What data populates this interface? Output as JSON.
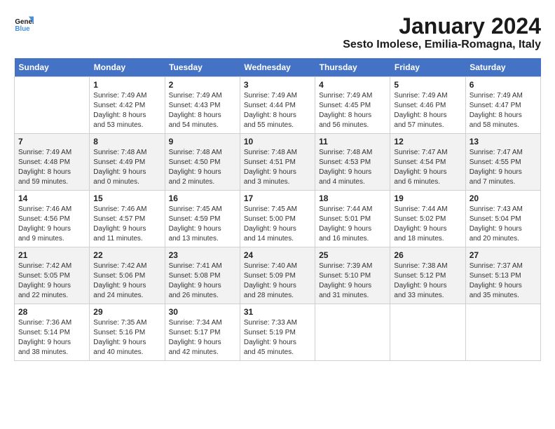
{
  "header": {
    "logo_line1": "General",
    "logo_line2": "Blue",
    "title": "January 2024",
    "subtitle": "Sesto Imolese, Emilia-Romagna, Italy"
  },
  "columns": [
    "Sunday",
    "Monday",
    "Tuesday",
    "Wednesday",
    "Thursday",
    "Friday",
    "Saturday"
  ],
  "weeks": [
    [
      {
        "day": "",
        "info": ""
      },
      {
        "day": "1",
        "info": "Sunrise: 7:49 AM\nSunset: 4:42 PM\nDaylight: 8 hours\nand 53 minutes."
      },
      {
        "day": "2",
        "info": "Sunrise: 7:49 AM\nSunset: 4:43 PM\nDaylight: 8 hours\nand 54 minutes."
      },
      {
        "day": "3",
        "info": "Sunrise: 7:49 AM\nSunset: 4:44 PM\nDaylight: 8 hours\nand 55 minutes."
      },
      {
        "day": "4",
        "info": "Sunrise: 7:49 AM\nSunset: 4:45 PM\nDaylight: 8 hours\nand 56 minutes."
      },
      {
        "day": "5",
        "info": "Sunrise: 7:49 AM\nSunset: 4:46 PM\nDaylight: 8 hours\nand 57 minutes."
      },
      {
        "day": "6",
        "info": "Sunrise: 7:49 AM\nSunset: 4:47 PM\nDaylight: 8 hours\nand 58 minutes."
      }
    ],
    [
      {
        "day": "7",
        "info": "Sunrise: 7:49 AM\nSunset: 4:48 PM\nDaylight: 8 hours\nand 59 minutes."
      },
      {
        "day": "8",
        "info": "Sunrise: 7:48 AM\nSunset: 4:49 PM\nDaylight: 9 hours\nand 0 minutes."
      },
      {
        "day": "9",
        "info": "Sunrise: 7:48 AM\nSunset: 4:50 PM\nDaylight: 9 hours\nand 2 minutes."
      },
      {
        "day": "10",
        "info": "Sunrise: 7:48 AM\nSunset: 4:51 PM\nDaylight: 9 hours\nand 3 minutes."
      },
      {
        "day": "11",
        "info": "Sunrise: 7:48 AM\nSunset: 4:53 PM\nDaylight: 9 hours\nand 4 minutes."
      },
      {
        "day": "12",
        "info": "Sunrise: 7:47 AM\nSunset: 4:54 PM\nDaylight: 9 hours\nand 6 minutes."
      },
      {
        "day": "13",
        "info": "Sunrise: 7:47 AM\nSunset: 4:55 PM\nDaylight: 9 hours\nand 7 minutes."
      }
    ],
    [
      {
        "day": "14",
        "info": "Sunrise: 7:46 AM\nSunset: 4:56 PM\nDaylight: 9 hours\nand 9 minutes."
      },
      {
        "day": "15",
        "info": "Sunrise: 7:46 AM\nSunset: 4:57 PM\nDaylight: 9 hours\nand 11 minutes."
      },
      {
        "day": "16",
        "info": "Sunrise: 7:45 AM\nSunset: 4:59 PM\nDaylight: 9 hours\nand 13 minutes."
      },
      {
        "day": "17",
        "info": "Sunrise: 7:45 AM\nSunset: 5:00 PM\nDaylight: 9 hours\nand 14 minutes."
      },
      {
        "day": "18",
        "info": "Sunrise: 7:44 AM\nSunset: 5:01 PM\nDaylight: 9 hours\nand 16 minutes."
      },
      {
        "day": "19",
        "info": "Sunrise: 7:44 AM\nSunset: 5:02 PM\nDaylight: 9 hours\nand 18 minutes."
      },
      {
        "day": "20",
        "info": "Sunrise: 7:43 AM\nSunset: 5:04 PM\nDaylight: 9 hours\nand 20 minutes."
      }
    ],
    [
      {
        "day": "21",
        "info": "Sunrise: 7:42 AM\nSunset: 5:05 PM\nDaylight: 9 hours\nand 22 minutes."
      },
      {
        "day": "22",
        "info": "Sunrise: 7:42 AM\nSunset: 5:06 PM\nDaylight: 9 hours\nand 24 minutes."
      },
      {
        "day": "23",
        "info": "Sunrise: 7:41 AM\nSunset: 5:08 PM\nDaylight: 9 hours\nand 26 minutes."
      },
      {
        "day": "24",
        "info": "Sunrise: 7:40 AM\nSunset: 5:09 PM\nDaylight: 9 hours\nand 28 minutes."
      },
      {
        "day": "25",
        "info": "Sunrise: 7:39 AM\nSunset: 5:10 PM\nDaylight: 9 hours\nand 31 minutes."
      },
      {
        "day": "26",
        "info": "Sunrise: 7:38 AM\nSunset: 5:12 PM\nDaylight: 9 hours\nand 33 minutes."
      },
      {
        "day": "27",
        "info": "Sunrise: 7:37 AM\nSunset: 5:13 PM\nDaylight: 9 hours\nand 35 minutes."
      }
    ],
    [
      {
        "day": "28",
        "info": "Sunrise: 7:36 AM\nSunset: 5:14 PM\nDaylight: 9 hours\nand 38 minutes."
      },
      {
        "day": "29",
        "info": "Sunrise: 7:35 AM\nSunset: 5:16 PM\nDaylight: 9 hours\nand 40 minutes."
      },
      {
        "day": "30",
        "info": "Sunrise: 7:34 AM\nSunset: 5:17 PM\nDaylight: 9 hours\nand 42 minutes."
      },
      {
        "day": "31",
        "info": "Sunrise: 7:33 AM\nSunset: 5:19 PM\nDaylight: 9 hours\nand 45 minutes."
      },
      {
        "day": "",
        "info": ""
      },
      {
        "day": "",
        "info": ""
      },
      {
        "day": "",
        "info": ""
      }
    ]
  ]
}
